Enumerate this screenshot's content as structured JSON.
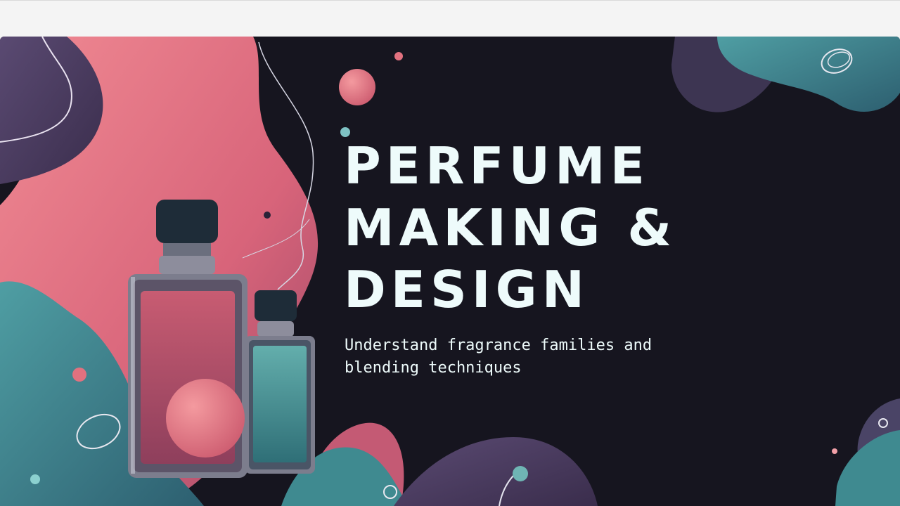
{
  "slide": {
    "title_lines": [
      "PERFUME",
      "MAKING &",
      "DESIGN"
    ],
    "subtitle": "Understand fragrance families and blending techniques"
  },
  "colors": {
    "background": "#16151f",
    "text": "#eefbfb",
    "pink": "#e2717f",
    "teal": "#3f8a90",
    "purple": "#4b3a5c"
  }
}
